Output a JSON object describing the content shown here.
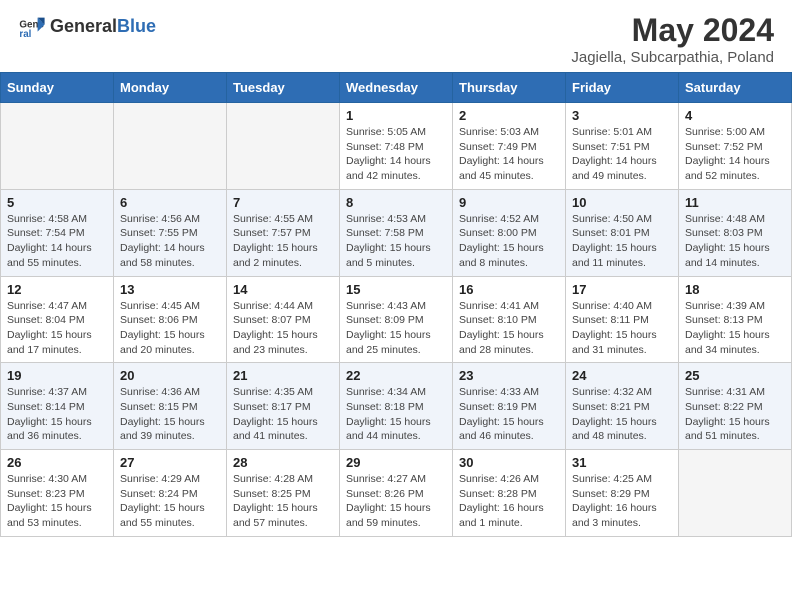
{
  "header": {
    "logo_general": "General",
    "logo_blue": "Blue",
    "month": "May 2024",
    "location": "Jagiella, Subcarpathia, Poland"
  },
  "days_of_week": [
    "Sunday",
    "Monday",
    "Tuesday",
    "Wednesday",
    "Thursday",
    "Friday",
    "Saturday"
  ],
  "weeks": [
    [
      {
        "day": "",
        "info": ""
      },
      {
        "day": "",
        "info": ""
      },
      {
        "day": "",
        "info": ""
      },
      {
        "day": "1",
        "info": "Sunrise: 5:05 AM\nSunset: 7:48 PM\nDaylight: 14 hours\nand 42 minutes."
      },
      {
        "day": "2",
        "info": "Sunrise: 5:03 AM\nSunset: 7:49 PM\nDaylight: 14 hours\nand 45 minutes."
      },
      {
        "day": "3",
        "info": "Sunrise: 5:01 AM\nSunset: 7:51 PM\nDaylight: 14 hours\nand 49 minutes."
      },
      {
        "day": "4",
        "info": "Sunrise: 5:00 AM\nSunset: 7:52 PM\nDaylight: 14 hours\nand 52 minutes."
      }
    ],
    [
      {
        "day": "5",
        "info": "Sunrise: 4:58 AM\nSunset: 7:54 PM\nDaylight: 14 hours\nand 55 minutes."
      },
      {
        "day": "6",
        "info": "Sunrise: 4:56 AM\nSunset: 7:55 PM\nDaylight: 14 hours\nand 58 minutes."
      },
      {
        "day": "7",
        "info": "Sunrise: 4:55 AM\nSunset: 7:57 PM\nDaylight: 15 hours\nand 2 minutes."
      },
      {
        "day": "8",
        "info": "Sunrise: 4:53 AM\nSunset: 7:58 PM\nDaylight: 15 hours\nand 5 minutes."
      },
      {
        "day": "9",
        "info": "Sunrise: 4:52 AM\nSunset: 8:00 PM\nDaylight: 15 hours\nand 8 minutes."
      },
      {
        "day": "10",
        "info": "Sunrise: 4:50 AM\nSunset: 8:01 PM\nDaylight: 15 hours\nand 11 minutes."
      },
      {
        "day": "11",
        "info": "Sunrise: 4:48 AM\nSunset: 8:03 PM\nDaylight: 15 hours\nand 14 minutes."
      }
    ],
    [
      {
        "day": "12",
        "info": "Sunrise: 4:47 AM\nSunset: 8:04 PM\nDaylight: 15 hours\nand 17 minutes."
      },
      {
        "day": "13",
        "info": "Sunrise: 4:45 AM\nSunset: 8:06 PM\nDaylight: 15 hours\nand 20 minutes."
      },
      {
        "day": "14",
        "info": "Sunrise: 4:44 AM\nSunset: 8:07 PM\nDaylight: 15 hours\nand 23 minutes."
      },
      {
        "day": "15",
        "info": "Sunrise: 4:43 AM\nSunset: 8:09 PM\nDaylight: 15 hours\nand 25 minutes."
      },
      {
        "day": "16",
        "info": "Sunrise: 4:41 AM\nSunset: 8:10 PM\nDaylight: 15 hours\nand 28 minutes."
      },
      {
        "day": "17",
        "info": "Sunrise: 4:40 AM\nSunset: 8:11 PM\nDaylight: 15 hours\nand 31 minutes."
      },
      {
        "day": "18",
        "info": "Sunrise: 4:39 AM\nSunset: 8:13 PM\nDaylight: 15 hours\nand 34 minutes."
      }
    ],
    [
      {
        "day": "19",
        "info": "Sunrise: 4:37 AM\nSunset: 8:14 PM\nDaylight: 15 hours\nand 36 minutes."
      },
      {
        "day": "20",
        "info": "Sunrise: 4:36 AM\nSunset: 8:15 PM\nDaylight: 15 hours\nand 39 minutes."
      },
      {
        "day": "21",
        "info": "Sunrise: 4:35 AM\nSunset: 8:17 PM\nDaylight: 15 hours\nand 41 minutes."
      },
      {
        "day": "22",
        "info": "Sunrise: 4:34 AM\nSunset: 8:18 PM\nDaylight: 15 hours\nand 44 minutes."
      },
      {
        "day": "23",
        "info": "Sunrise: 4:33 AM\nSunset: 8:19 PM\nDaylight: 15 hours\nand 46 minutes."
      },
      {
        "day": "24",
        "info": "Sunrise: 4:32 AM\nSunset: 8:21 PM\nDaylight: 15 hours\nand 48 minutes."
      },
      {
        "day": "25",
        "info": "Sunrise: 4:31 AM\nSunset: 8:22 PM\nDaylight: 15 hours\nand 51 minutes."
      }
    ],
    [
      {
        "day": "26",
        "info": "Sunrise: 4:30 AM\nSunset: 8:23 PM\nDaylight: 15 hours\nand 53 minutes."
      },
      {
        "day": "27",
        "info": "Sunrise: 4:29 AM\nSunset: 8:24 PM\nDaylight: 15 hours\nand 55 minutes."
      },
      {
        "day": "28",
        "info": "Sunrise: 4:28 AM\nSunset: 8:25 PM\nDaylight: 15 hours\nand 57 minutes."
      },
      {
        "day": "29",
        "info": "Sunrise: 4:27 AM\nSunset: 8:26 PM\nDaylight: 15 hours\nand 59 minutes."
      },
      {
        "day": "30",
        "info": "Sunrise: 4:26 AM\nSunset: 8:28 PM\nDaylight: 16 hours\nand 1 minute."
      },
      {
        "day": "31",
        "info": "Sunrise: 4:25 AM\nSunset: 8:29 PM\nDaylight: 16 hours\nand 3 minutes."
      },
      {
        "day": "",
        "info": ""
      }
    ]
  ]
}
